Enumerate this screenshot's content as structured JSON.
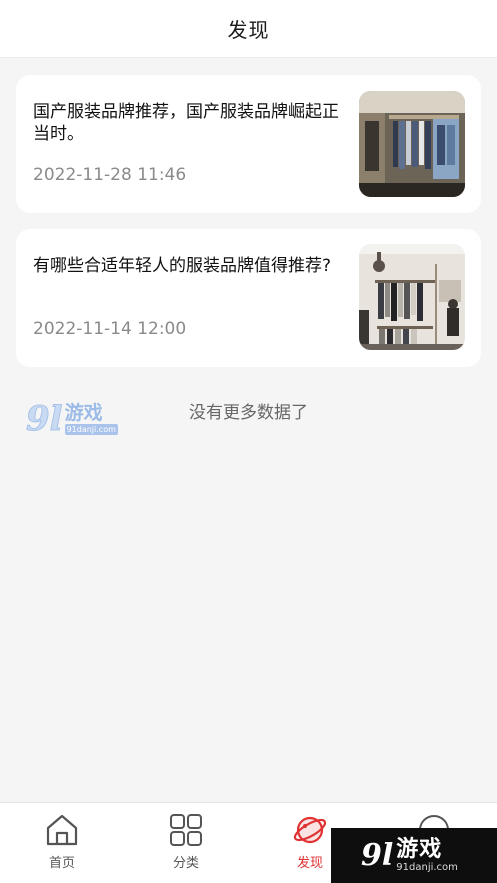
{
  "header": {
    "title": "发现"
  },
  "articles": [
    {
      "title": "国产服装品牌推荐，国产服装品牌崛起正当时。",
      "date": "2022-11-28 11:46",
      "thumb_icon": "clothing-store-photo"
    },
    {
      "title": "有哪些合适年轻人的服装品牌值得推荐?",
      "date": "2022-11-14 12:00",
      "thumb_icon": "clothing-rack-photo"
    }
  ],
  "list_end_text": "没有更多数据了",
  "watermark": {
    "number": "9l",
    "name": "游戏",
    "url": "91danji.com"
  },
  "tabbar": {
    "items": [
      {
        "label": "首页",
        "icon": "home-icon",
        "active": false
      },
      {
        "label": "分类",
        "icon": "category-grid-icon",
        "active": false
      },
      {
        "label": "发现",
        "icon": "planet-icon",
        "active": true
      }
    ]
  },
  "colors": {
    "accent": "#e03232",
    "background": "#f5f5f5",
    "card": "#ffffff",
    "muted_text": "#8a8a8a"
  }
}
